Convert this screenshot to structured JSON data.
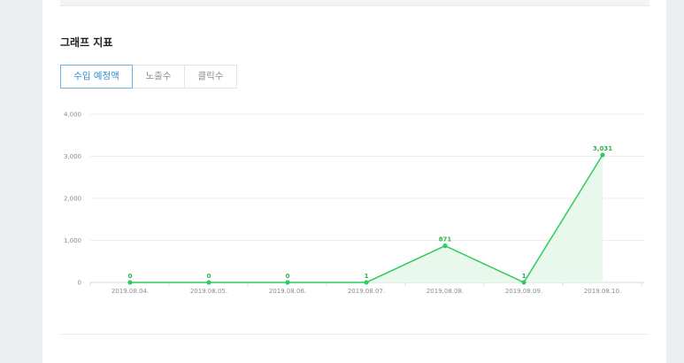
{
  "section": {
    "title": "그래프 지표"
  },
  "tabs": [
    {
      "label": "수입 예정액",
      "active": true
    },
    {
      "label": "노출수",
      "active": false
    },
    {
      "label": "클릭수",
      "active": false
    }
  ],
  "colors": {
    "line": "#2ecc5a",
    "fill": "#e9f8ec",
    "tab_active": "#2f8fd8"
  },
  "chart_data": {
    "type": "line",
    "title": "",
    "xlabel": "",
    "ylabel": "",
    "categories": [
      "2019.08.04.",
      "2019.08.05.",
      "2019.08.06.",
      "2019.08.07.",
      "2019.08.08.",
      "2019.08.09.",
      "2019.08.10."
    ],
    "values": [
      0,
      0,
      0,
      1,
      871,
      1,
      3031
    ],
    "data_labels": [
      "0",
      "0",
      "0",
      "1",
      "871",
      "1",
      "3,031"
    ],
    "yticks": [
      0,
      1000,
      2000,
      3000,
      4000
    ],
    "ytick_labels": [
      "0",
      "1,000",
      "2,000",
      "3,000",
      "4,000"
    ],
    "ylim": [
      0,
      4000
    ],
    "grid": true,
    "area_fill": true
  }
}
